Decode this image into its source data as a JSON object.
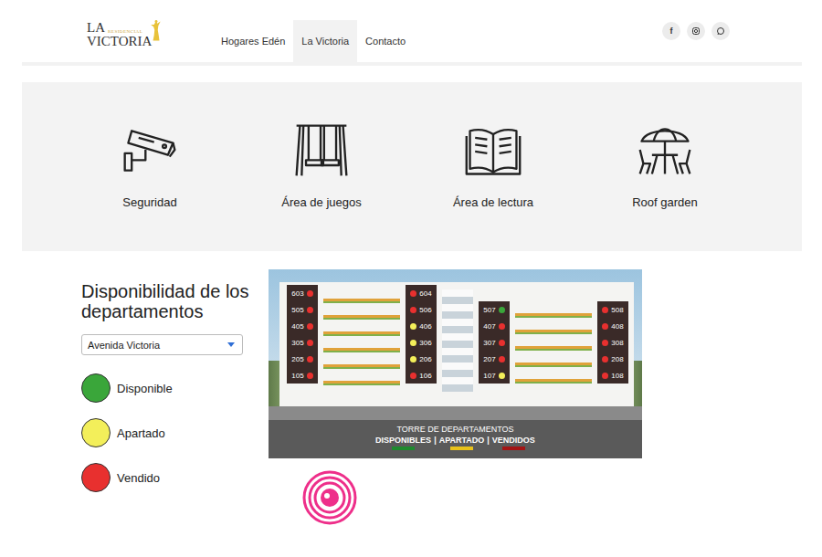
{
  "logo": {
    "top": "LA",
    "tagline": "RESIDENCIAL",
    "name": "VICTORIA"
  },
  "nav": [
    {
      "label": "Hogares Edén",
      "selected": false
    },
    {
      "label": "La Victoria",
      "selected": true
    },
    {
      "label": "Contacto",
      "selected": false
    }
  ],
  "social": [
    {
      "kind": "facebook",
      "glyph": "f"
    },
    {
      "kind": "instagram"
    },
    {
      "kind": "whatsapp"
    }
  ],
  "amenities": [
    {
      "label": "Seguridad",
      "kind": "camera"
    },
    {
      "label": "Área de juegos",
      "kind": "swing"
    },
    {
      "label": "Área de lectura",
      "kind": "book"
    },
    {
      "label": "Roof garden",
      "kind": "table"
    }
  ],
  "availability": {
    "title": "Disponibilidad de los departamentos",
    "select": {
      "value": "Avenida Victoria"
    },
    "legend": [
      {
        "label": "Disponible",
        "color": "#3aa63a"
      },
      {
        "label": "Apartado",
        "color": "#f3ef5a"
      },
      {
        "label": "Vendido",
        "color": "#e8302f"
      }
    ]
  },
  "tower": {
    "columns": [
      {
        "units": [
          {
            "number": "603",
            "color": "#e8302f"
          },
          {
            "number": "505",
            "color": "#e8302f"
          },
          {
            "number": "405",
            "color": "#e8302f"
          },
          {
            "number": "305",
            "color": "#e8302f"
          },
          {
            "number": "205",
            "color": "#e8302f"
          },
          {
            "number": "105",
            "color": "#e8302f"
          }
        ]
      },
      {
        "units": [
          {
            "number": "604",
            "color": "#e8302f"
          },
          {
            "number": "506",
            "color": "#e8302f"
          },
          {
            "number": "406",
            "color": "#f3ef5a"
          },
          {
            "number": "306",
            "color": "#f3ef5a"
          },
          {
            "number": "206",
            "color": "#f3ef5a"
          },
          {
            "number": "106",
            "color": "#e8302f"
          }
        ]
      },
      {
        "units": [
          {
            "number": "507",
            "color": "#3aa63a"
          },
          {
            "number": "407",
            "color": "#e8302f"
          },
          {
            "number": "307",
            "color": "#e8302f"
          },
          {
            "number": "207",
            "color": "#e8302f"
          },
          {
            "number": "107",
            "color": "#f3ef5a"
          }
        ]
      },
      {
        "units": [
          {
            "number": "508",
            "color": "#e8302f"
          },
          {
            "number": "408",
            "color": "#e8302f"
          },
          {
            "number": "308",
            "color": "#e8302f"
          },
          {
            "number": "208",
            "color": "#e8302f"
          },
          {
            "number": "108",
            "color": "#e8302f"
          }
        ]
      }
    ],
    "caption": {
      "title": "TORRE DE DEPARTAMENTOS",
      "separator": "|",
      "legend": [
        {
          "label": "DISPONIBLES",
          "color": "#1f8a2e"
        },
        {
          "label": "APARTADO",
          "color": "#e8c21a"
        },
        {
          "label": "VENDIDOS",
          "color": "#a31515"
        }
      ]
    }
  }
}
